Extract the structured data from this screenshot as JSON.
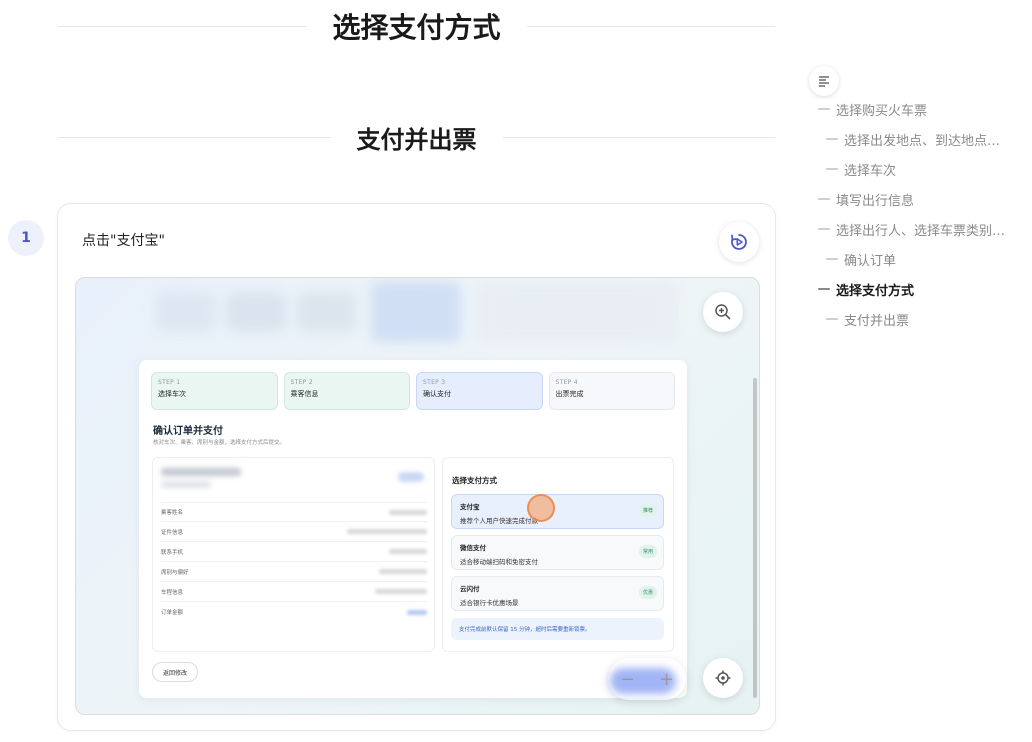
{
  "sections": {
    "title1": "选择支付方式",
    "title2": "支付并出票"
  },
  "step": {
    "number": "1",
    "instruction": "点击\"支付宝\""
  },
  "screenshot": {
    "stepper": [
      {
        "key": "STEP 1",
        "label": "选择车次",
        "state": "done"
      },
      {
        "key": "STEP 2",
        "label": "乘客信息",
        "state": "done"
      },
      {
        "key": "STEP 3",
        "label": "确认支付",
        "state": "active"
      },
      {
        "key": "STEP 4",
        "label": "出票完成",
        "state": "todo"
      }
    ],
    "heading": "确认订单并支付",
    "subheading": "核对车次、乘客、席别与金额，选择支付方式后提交。",
    "order_rows": [
      "乘客姓名",
      "证件信息",
      "联系手机",
      "席别与偏好",
      "车程信息",
      "订单金额"
    ],
    "pay_title": "选择支付方式",
    "pay_options": [
      {
        "name": "支付宝",
        "desc": "推荐个人用户快速完成付款",
        "tag": "推荐"
      },
      {
        "name": "微信支付",
        "desc": "适合移动端扫码和免密支付",
        "tag": "常用"
      },
      {
        "name": "云闪付",
        "desc": "适合银行卡优惠场景",
        "tag": "优惠"
      }
    ],
    "pay_note": "支付完成前默认保留 15 分钟，超时后需要重新锁票。",
    "back_button": "返回修改"
  },
  "toc": [
    {
      "label": "选择购买火车票",
      "level": 1,
      "active": false
    },
    {
      "label": "选择出发地点、到达地点…",
      "level": 2,
      "active": false
    },
    {
      "label": "选择车次",
      "level": 2,
      "active": false
    },
    {
      "label": "填写出行信息",
      "level": 1,
      "active": false
    },
    {
      "label": "选择出行人、选择车票类别…",
      "level": 1,
      "active": false
    },
    {
      "label": "确认订单",
      "level": 2,
      "active": false
    },
    {
      "label": "选择支付方式",
      "level": 1,
      "active": true
    },
    {
      "label": "支付并出票",
      "level": 2,
      "active": false
    }
  ],
  "icons": {
    "replay": "replay-icon",
    "zoom_in": "zoom-in-icon",
    "locate": "locate-icon",
    "toc": "toc-list-icon"
  },
  "colors": {
    "accent": "#4a57c9",
    "click_marker": "#f29a5a"
  }
}
